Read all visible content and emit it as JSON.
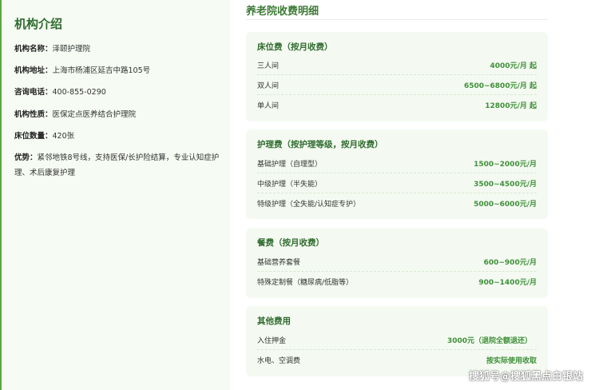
{
  "institution": {
    "title": "机构介绍",
    "rows": [
      {
        "label": "机构名称：",
        "value": "泽颐护理院"
      },
      {
        "label": "机构地址：",
        "value": "上海市杨浦区延吉中路105号"
      },
      {
        "label": "咨询电话：",
        "value": "400-855-0290"
      },
      {
        "label": "机构性质：",
        "value": "医保定点医养结合护理院"
      },
      {
        "label": "床位数量：",
        "value": "420张"
      },
      {
        "label": "优势：",
        "value": "紧邻地铁8号线，支持医保/长护险结算，专业认知症护理、术后康复护理"
      }
    ]
  },
  "fees": {
    "title": "养老院收费明细",
    "sections": [
      {
        "heading": "床位费（按月收费）",
        "items": [
          {
            "name": "三人间",
            "price": "4000元/月 起"
          },
          {
            "name": "双人间",
            "price": "6500~6800元/月 起"
          },
          {
            "name": "单人间",
            "price": "12800元/月 起"
          }
        ]
      },
      {
        "heading": "护理费（按护理等级，按月收费）",
        "items": [
          {
            "name": "基础护理（自理型）",
            "price": "1500~2000元/月"
          },
          {
            "name": "中级护理（半失能）",
            "price": "3500~4500元/月"
          },
          {
            "name": "特级护理（全失能/认知症专护）",
            "price": "5000~6000元/月"
          }
        ]
      },
      {
        "heading": "餐费（按月收费）",
        "items": [
          {
            "name": "基础营养套餐",
            "price": "600~900元/月"
          },
          {
            "name": "特殊定制餐（糖尿病/低脂等）",
            "price": "900~1400元/月"
          }
        ]
      },
      {
        "heading": "其他费用",
        "items": [
          {
            "name": "入住押金",
            "price": "3000元（退院全额退还）"
          },
          {
            "name": "水电、空调费",
            "price": "按实际使用收取"
          }
        ]
      }
    ]
  },
  "watermark": "搜狐号@搜狐黑点白银站",
  "colors": {
    "accent": "#3c7a35",
    "price": "#3f8f3a",
    "card_bg": "#f4faf1",
    "panel_bg": "#f6fbf3"
  }
}
